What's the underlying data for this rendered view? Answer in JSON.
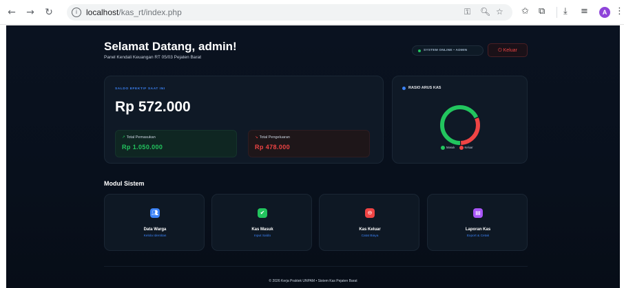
{
  "browser": {
    "url_host": "localhost",
    "url_path": "/kas_rt/index.php",
    "profile_initial": "A"
  },
  "header": {
    "welcome": "Selamat Datang, admin!",
    "subtitle": "Panel Kendali Keuangan RT 05/03 Pejaten Barat",
    "status": "SYSTEM ONLINE • ADMIN",
    "logout": "Keluar"
  },
  "balance": {
    "label": "SALDO EFEKTIF SAAT INI",
    "value": "Rp 572.000",
    "income_label": "Total Pemasukan",
    "income_value": "Rp 1.050.000",
    "expense_label": "Total Pengeluaran",
    "expense_value": "Rp 478.000"
  },
  "ratio": {
    "title": "RASIO ARUS KAS",
    "legend_in": "Masuk",
    "legend_out": "Keluar",
    "income_amount": 1050000,
    "expense_amount": 478000,
    "color_in": "#22c55e",
    "color_out": "#ef4444"
  },
  "modules": {
    "title": "Modul Sistem",
    "items": [
      {
        "title": "Data Warga",
        "subtitle": "Kelola Identitas",
        "icon": "users-icon",
        "color": "#3b82f6"
      },
      {
        "title": "Kas Masuk",
        "subtitle": "Input Saldo",
        "icon": "check-circle-icon",
        "color": "#22c55e"
      },
      {
        "title": "Kas Keluar",
        "subtitle": "Catat Biaya",
        "icon": "minus-circle-icon",
        "color": "#ef4444"
      },
      {
        "title": "Laporan Kas",
        "subtitle": "Export & Cetak",
        "icon": "document-icon",
        "color": "#a855f7"
      }
    ]
  },
  "footer": "© 2026 Kerja Praktek UNPAM • Sistem Kas Pejaten Barat"
}
